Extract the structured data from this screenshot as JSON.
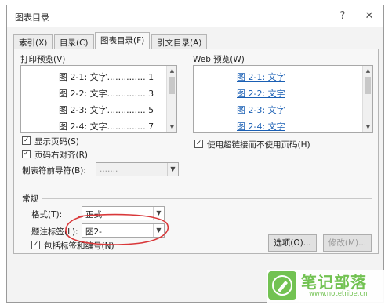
{
  "window": {
    "title": "图表目录",
    "help": "?",
    "close": "✕"
  },
  "tabs": [
    {
      "label": "索引(X)"
    },
    {
      "label": "目录(C)"
    },
    {
      "label": "图表目录(F)"
    },
    {
      "label": "引文目录(A)"
    }
  ],
  "print_preview": {
    "label": "打印预览(V)",
    "entries": [
      {
        "text": "图 2-1: 文字.............. 1"
      },
      {
        "text": "图 2-2: 文字.............. 3"
      },
      {
        "text": "图 2-3: 文字.............. 5"
      },
      {
        "text": "图 2-4: 文字.............. 7"
      }
    ]
  },
  "web_preview": {
    "label": "Web 预览(W)",
    "entries": [
      {
        "text": "图 2-1: 文字"
      },
      {
        "text": "图 2-2: 文字"
      },
      {
        "text": "图 2-3: 文字"
      },
      {
        "text": "图 2-4: 文字"
      }
    ]
  },
  "options": {
    "show_page_numbers": {
      "label": "显示页码(S)",
      "checked": true
    },
    "right_align": {
      "label": "页码右对齐(R)",
      "checked": true
    },
    "tab_leader": {
      "label": "制表符前导符(B):",
      "value": "......."
    },
    "use_hyperlinks": {
      "label": "使用超链接而不使用页码(H)",
      "checked": true
    }
  },
  "general": {
    "label": "常规",
    "format": {
      "label": "格式(T):",
      "value": "正式"
    },
    "caption_label": {
      "label": "题注标签(L):",
      "value": "图2-"
    },
    "include_label": {
      "label": "包括标签和编号(N)",
      "checked": true
    }
  },
  "buttons": {
    "options": "选项(O)...",
    "modify": "修改(M)..."
  },
  "watermark": {
    "name": "笔记部落",
    "url": "www.notetribe.cn"
  },
  "colors": {
    "link": "#1a5fb4",
    "highlight": "#d9383a",
    "watermark": "#6cc04a"
  }
}
